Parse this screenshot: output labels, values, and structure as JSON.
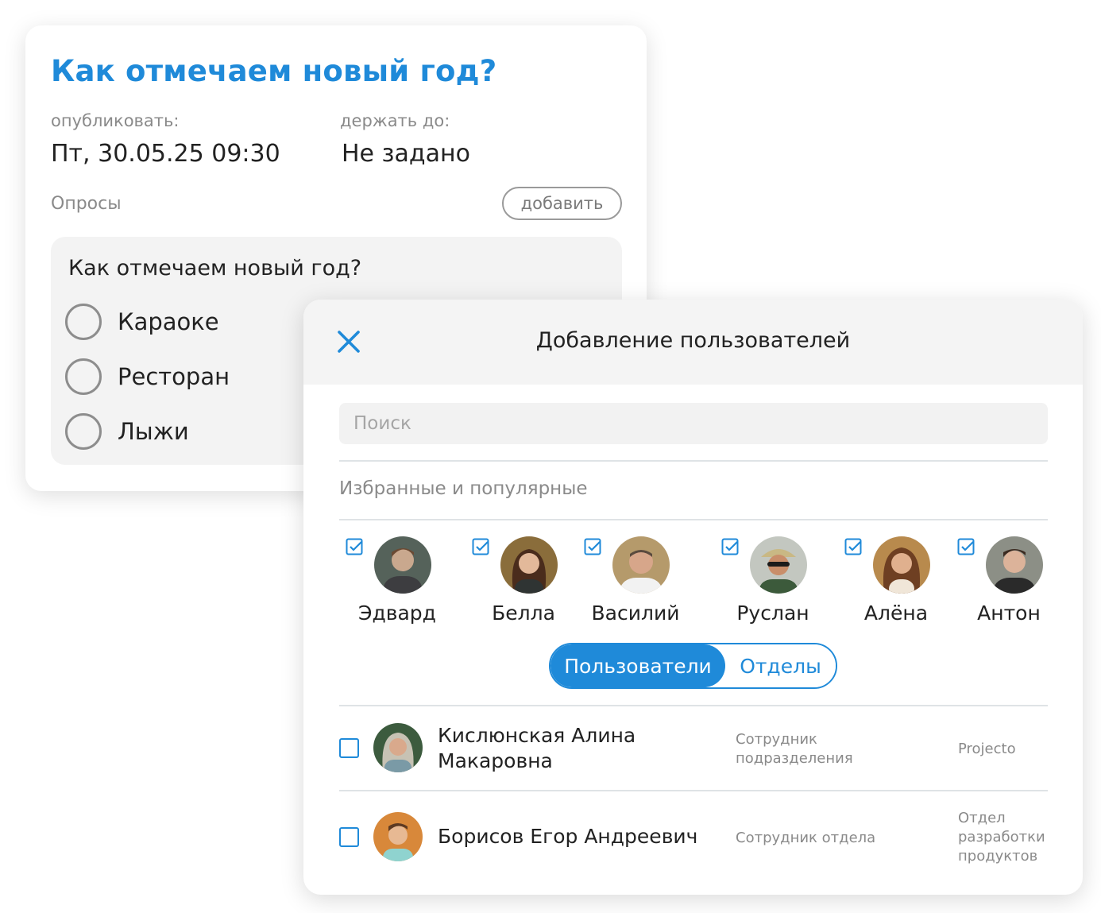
{
  "poll_card": {
    "title": "Как отмечаем новый год?",
    "publish_label": "опубликовать:",
    "publish_value": "Пт, 30.05.25 09:30",
    "hold_label": "держать до:",
    "hold_value": "Не задано",
    "polls_label": "Опросы",
    "add_button": "добавить",
    "poll": {
      "question": "Как отмечаем новый год?",
      "options": [
        "Караоке",
        "Ресторан",
        "Лыжи"
      ]
    }
  },
  "dialog": {
    "title": "Добавление пользователей",
    "close_icon": "close-icon",
    "search_placeholder": "Поиск",
    "favorites_label": "Избранные и популярные",
    "favorites": [
      {
        "name": "Эдвард",
        "checked": true
      },
      {
        "name": "Белла",
        "checked": true
      },
      {
        "name": "Василий",
        "checked": true
      },
      {
        "name": "Руслан",
        "checked": true
      },
      {
        "name": "Алёна",
        "checked": true
      },
      {
        "name": "Антон",
        "checked": true
      }
    ],
    "tabs": {
      "users": "Пользователи",
      "departments": "Отделы",
      "active": "users"
    },
    "users": [
      {
        "name_line1": "Кислюнская Алина",
        "name_line2": "Макаровна",
        "role_line1": "Сотрудник",
        "role_line2": "подразделения",
        "dept_line1": "Projecto",
        "dept_line2": "",
        "dept_line3": ""
      },
      {
        "name_line1": "Борисов Егор Андреевич",
        "name_line2": "",
        "role_line1": "Сотрудник отдела",
        "role_line2": "",
        "dept_line1": "Отдел",
        "dept_line2": "разработки",
        "dept_line3": "продуктов"
      }
    ]
  },
  "colors": {
    "accent": "#1f8ad9",
    "muted": "#8a8a8a",
    "text": "#222222"
  }
}
